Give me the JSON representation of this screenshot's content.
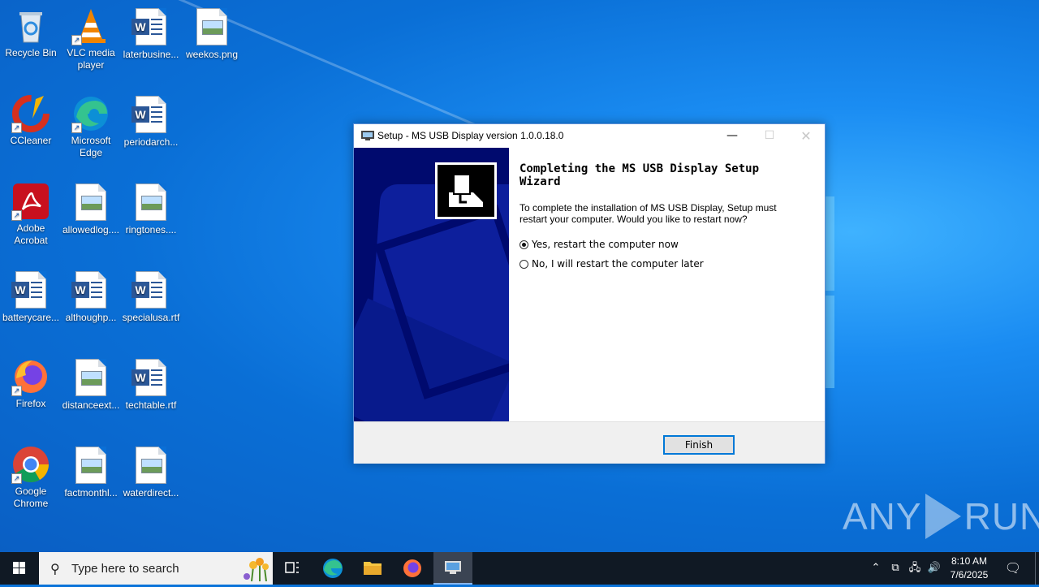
{
  "desktop": {
    "icons": [
      {
        "label": "Recycle Bin"
      },
      {
        "label": "VLC media player"
      },
      {
        "label": "laterbusine..."
      },
      {
        "label": "weekos.png"
      },
      {
        "label": "CCleaner"
      },
      {
        "label": "Microsoft Edge"
      },
      {
        "label": "periodarch..."
      },
      {
        "label": "Adobe Acrobat"
      },
      {
        "label": "allowedlog...."
      },
      {
        "label": "ringtones...."
      },
      {
        "label": "batterycare..."
      },
      {
        "label": "althoughp..."
      },
      {
        "label": "specialusa.rtf"
      },
      {
        "label": "Firefox"
      },
      {
        "label": "distanceext..."
      },
      {
        "label": "techtable.rtf"
      },
      {
        "label": "Google Chrome"
      },
      {
        "label": "factmonthl..."
      },
      {
        "label": "waterdirect..."
      }
    ]
  },
  "setup_window": {
    "title": "Setup - MS USB Display version 1.0.0.18.0",
    "heading": "Completing the MS USB Display Setup Wizard",
    "description": "To complete the installation of MS USB Display, Setup must restart your computer. Would you like to restart now?",
    "options": [
      {
        "label": "Yes, restart the computer now",
        "checked": true
      },
      {
        "label": "No, I will restart the computer later",
        "checked": false
      }
    ],
    "finish_label": "Finish"
  },
  "watermark": {
    "left": "ANY",
    "right": "RUN"
  },
  "taskbar": {
    "search_placeholder": "Type here to search",
    "time": "8:10 AM",
    "date": "7/6/2025"
  },
  "colors": {
    "accent": "#0078d7",
    "taskbar": "#101924",
    "banner": "#000a6e"
  }
}
